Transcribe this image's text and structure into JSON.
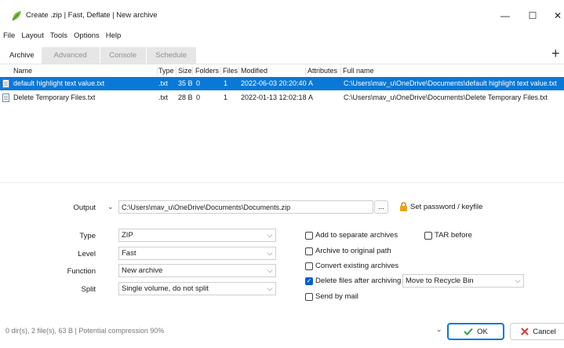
{
  "window": {
    "title": "Create .zip | Fast, Deflate | New archive",
    "minimize_glyph": "—",
    "maximize_glyph": "☐",
    "close_glyph": "✕"
  },
  "menu": [
    "File",
    "Layout",
    "Tools",
    "Options",
    "Help"
  ],
  "tabs": [
    {
      "label": "Archive",
      "active": true
    },
    {
      "label": "Advanced",
      "active": false
    },
    {
      "label": "Console",
      "active": false
    },
    {
      "label": "Schedule",
      "active": false
    }
  ],
  "add_tab_glyph": "+",
  "file_table": {
    "columns": [
      "Name",
      "Type",
      "Size",
      "Folders",
      "Files",
      "Modified",
      "Attributes",
      "Full name"
    ],
    "rows": [
      {
        "name": "default highlight text value.txt",
        "type": ".txt",
        "size": "35 B",
        "folders": "0",
        "files": "1",
        "modified": "2022-06-03 20:20:40",
        "attributes": "A",
        "full_name": "C:\\Users\\mav_u\\OneDrive\\Documents\\default highlight text value.txt",
        "selected": true
      },
      {
        "name": "Delete Temporary Files.txt",
        "type": ".txt",
        "size": "28 B",
        "folders": "0",
        "files": "1",
        "modified": "2022-01-13 12:02:18",
        "attributes": "A",
        "full_name": "C:\\Users\\mav_u\\OneDrive\\Documents\\Delete Temporary Files.txt",
        "selected": false
      }
    ]
  },
  "output": {
    "label": "Output",
    "path": "C:\\Users\\mav_u\\OneDrive\\Documents\\Documents.zip",
    "browse_label": "...",
    "password_label": "Set password / keyfile"
  },
  "options": {
    "type": {
      "label": "Type",
      "value": "ZIP"
    },
    "level": {
      "label": "Level",
      "value": "Fast"
    },
    "function": {
      "label": "Function",
      "value": "New archive"
    },
    "split": {
      "label": "Split",
      "value": "Single volume, do not split"
    }
  },
  "checkboxes": {
    "add_to_separate": {
      "label": "Add to separate archives",
      "checked": false
    },
    "tar_before": {
      "label": "TAR before",
      "checked": false
    },
    "archive_to_original": {
      "label": "Archive to original path",
      "checked": false
    },
    "convert_existing": {
      "label": "Convert existing archives",
      "checked": false
    },
    "delete_after": {
      "label": "Delete files after archiving",
      "checked": true
    },
    "send_by_mail": {
      "label": "Send by mail",
      "checked": false
    }
  },
  "delete_target": "Move to Recycle Bin",
  "status": "0 dir(s), 2 file(s), 63 B | Potential compression 90%",
  "buttons": {
    "ok": "OK",
    "cancel": "Cancel"
  },
  "colors": {
    "selection": "#0a78d7",
    "accent": "#0a5fd0",
    "ok_check": "#2aa640",
    "cancel_x": "#d83b3b"
  }
}
